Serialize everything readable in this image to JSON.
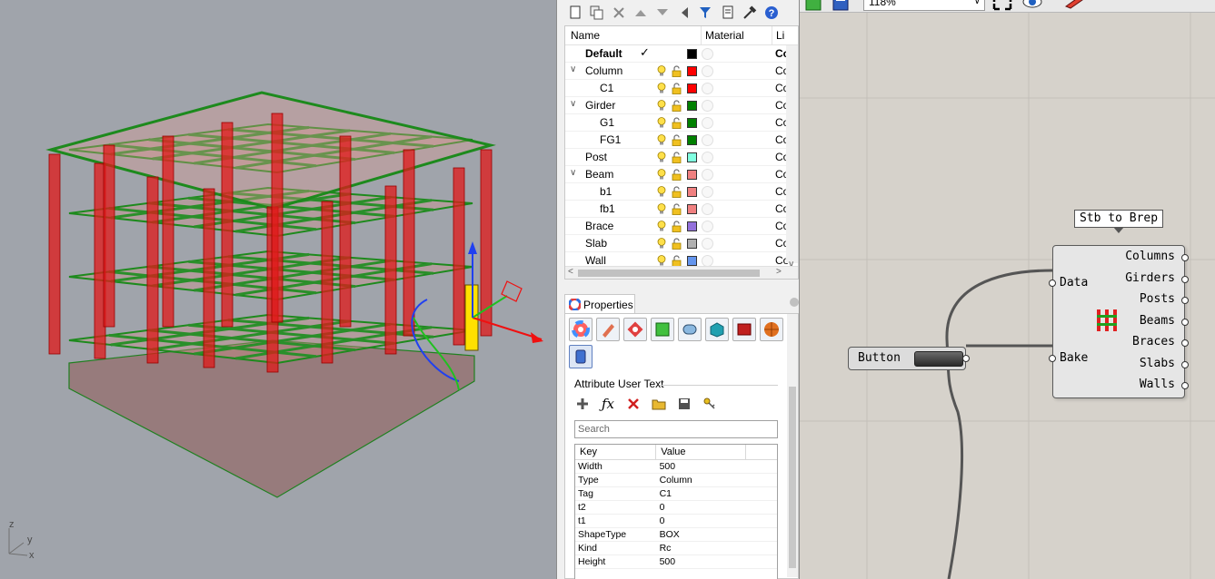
{
  "viewport": {
    "axes": {
      "z": "z",
      "y": "y",
      "x": "x"
    }
  },
  "layers": {
    "headers": {
      "name": "Name",
      "material": "Material",
      "linetype": "Li"
    },
    "rows": [
      {
        "name": "Default",
        "indent": 0,
        "expand": "",
        "current": "✓",
        "color": "#000000",
        "li": "Co",
        "bold": true
      },
      {
        "name": "Column",
        "indent": 0,
        "expand": "∨",
        "current": "",
        "color": "#ff0000",
        "li": "Co",
        "bold": false
      },
      {
        "name": "C1",
        "indent": 1,
        "expand": "",
        "current": "",
        "color": "#ff0000",
        "li": "Co",
        "bold": false
      },
      {
        "name": "Girder",
        "indent": 0,
        "expand": "∨",
        "current": "",
        "color": "#008000",
        "li": "Co",
        "bold": false
      },
      {
        "name": "G1",
        "indent": 1,
        "expand": "",
        "current": "",
        "color": "#008000",
        "li": "Co",
        "bold": false
      },
      {
        "name": "FG1",
        "indent": 1,
        "expand": "",
        "current": "",
        "color": "#008000",
        "li": "Co",
        "bold": false
      },
      {
        "name": "Post",
        "indent": 0,
        "expand": "",
        "current": "",
        "color": "#80ffe0",
        "li": "Co",
        "bold": false
      },
      {
        "name": "Beam",
        "indent": 0,
        "expand": "∨",
        "current": "",
        "color": "#f08080",
        "li": "Co",
        "bold": false
      },
      {
        "name": "b1",
        "indent": 1,
        "expand": "",
        "current": "",
        "color": "#f08080",
        "li": "Co",
        "bold": false
      },
      {
        "name": "fb1",
        "indent": 1,
        "expand": "",
        "current": "",
        "color": "#f08080",
        "li": "Co",
        "bold": false
      },
      {
        "name": "Brace",
        "indent": 0,
        "expand": "",
        "current": "",
        "color": "#9370db",
        "li": "Co",
        "bold": false
      },
      {
        "name": "Slab",
        "indent": 0,
        "expand": "",
        "current": "",
        "color": "#b0b0b0",
        "li": "Co",
        "bold": false
      },
      {
        "name": "Wall",
        "indent": 0,
        "expand": "",
        "current": "",
        "color": "#6495ed",
        "li": "Co",
        "bold": false
      }
    ]
  },
  "properties": {
    "tab_label": "Properties",
    "section_title": "Attribute User Text",
    "search_placeholder": "Search",
    "table_headers": {
      "key": "Key",
      "value": "Value"
    },
    "rows": [
      {
        "key": "Width",
        "value": "500"
      },
      {
        "key": "Type",
        "value": "Column"
      },
      {
        "key": "Tag",
        "value": "C1"
      },
      {
        "key": "t2",
        "value": "0"
      },
      {
        "key": "t1",
        "value": "0"
      },
      {
        "key": "ShapeType",
        "value": "BOX"
      },
      {
        "key": "Kind",
        "value": "Rc"
      },
      {
        "key": "Height",
        "value": "500"
      }
    ]
  },
  "grasshopper": {
    "zoom_value": "118%",
    "component_tooltip": "Stb to Brep",
    "inputs": [
      "Data",
      "Bake"
    ],
    "outputs": [
      "Columns",
      "Girders",
      "Posts",
      "Beams",
      "Braces",
      "Slabs",
      "Walls"
    ],
    "button_label": "Button"
  }
}
